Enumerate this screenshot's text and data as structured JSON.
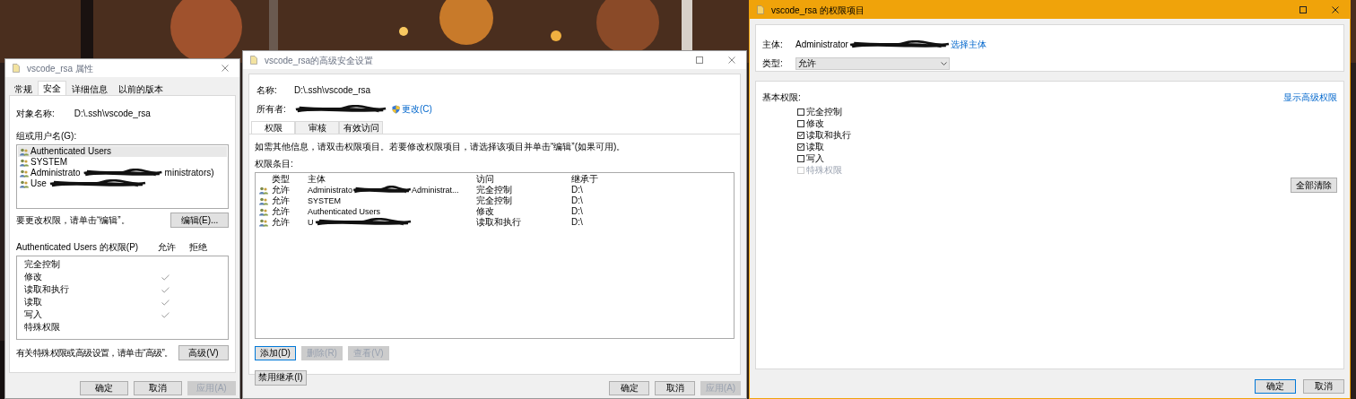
{
  "left_dialog": {
    "title": "vscode_rsa 属性",
    "active": false,
    "tabs": [
      {
        "label": "常规",
        "selected": false
      },
      {
        "label": "安全",
        "selected": true
      },
      {
        "label": "详细信息",
        "selected": false
      },
      {
        "label": "以前的版本",
        "selected": false
      }
    ],
    "object_name_label": "对象名称:",
    "object_name": "D:\\.ssh\\vscode_rsa",
    "groups_label": "组或用户名(G):",
    "groups": [
      {
        "name": "Authenticated Users",
        "redacted": false,
        "selected": true
      },
      {
        "name": "SYSTEM",
        "redacted": false,
        "selected": false
      },
      {
        "name": "Administrato",
        "suffix": "ministrators)",
        "redacted": true,
        "selected": false
      },
      {
        "name": "Use",
        "redacted": true,
        "selected": false
      }
    ],
    "edit_hint": "要更改权限，请单击“编辑”。",
    "edit_button": "编辑(E)...",
    "permissions_label": "Authenticated Users 的权限(P)",
    "allow_header": "允许",
    "deny_header": "拒绝",
    "permissions": [
      {
        "name": "完全控制",
        "allow": false
      },
      {
        "name": "修改",
        "allow": true
      },
      {
        "name": "读取和执行",
        "allow": true
      },
      {
        "name": "读取",
        "allow": true
      },
      {
        "name": "写入",
        "allow": true
      },
      {
        "name": "特殊权限",
        "allow": false
      }
    ],
    "advanced_hint": "有关特殊权限或高级设置，请单击“高级”。",
    "advanced_button": "高级(V)",
    "footer_buttons": [
      {
        "label": "确定",
        "disabled": false,
        "focused": false
      },
      {
        "label": "取消",
        "disabled": false,
        "focused": false
      },
      {
        "label": "应用(A)",
        "disabled": true,
        "focused": false
      }
    ]
  },
  "middle_dialog": {
    "title": "vscode_rsa的高级安全设置",
    "active": false,
    "name_label": "名称:",
    "name": "D:\\.ssh\\vscode_rsa",
    "owner_label": "所有者:",
    "owner_redacted": true,
    "change_link": "更改(C)",
    "tabs": [
      {
        "label": "权限",
        "selected": true
      },
      {
        "label": "审核",
        "selected": false
      },
      {
        "label": "有效访问",
        "selected": false
      }
    ],
    "info": "如需其他信息，请双击权限项目。若要修改权限项目，请选择该项目并单击“编辑”(如果可用)。",
    "entries_label": "权限条目:",
    "columns": [
      "类型",
      "主体",
      "访问",
      "继承于"
    ],
    "rows": [
      {
        "type": "允许",
        "principal": "Administrato",
        "principal_suffix": "Administrat...",
        "redacted": true,
        "access": "完全控制",
        "inherited_from": "D:\\"
      },
      {
        "type": "允许",
        "principal": "SYSTEM",
        "redacted": false,
        "access": "完全控制",
        "inherited_from": "D:\\"
      },
      {
        "type": "允许",
        "principal": "Authenticated Users",
        "redacted": false,
        "access": "修改",
        "inherited_from": "D:\\"
      },
      {
        "type": "允许",
        "principal": "U",
        "redacted": true,
        "access": "读取和执行",
        "inherited_from": "D:\\"
      }
    ],
    "buttons": [
      {
        "label": "添加(D)",
        "disabled": false,
        "focused": true
      },
      {
        "label": "删除(R)",
        "disabled": true,
        "focused": false
      },
      {
        "label": "查看(V)",
        "disabled": true,
        "focused": false
      }
    ],
    "disable_inheritance_button": "禁用继承(I)",
    "footer_buttons": [
      {
        "label": "确定",
        "disabled": false,
        "focused": false
      },
      {
        "label": "取消",
        "disabled": false,
        "focused": false
      },
      {
        "label": "应用(A)",
        "disabled": true,
        "focused": false
      }
    ]
  },
  "right_dialog": {
    "title": "vscode_rsa 的权限项目",
    "active": true,
    "principal_label": "主体:",
    "principal": "Administrator",
    "principal_redacted": true,
    "select_principal_link": "选择主体",
    "type_label": "类型:",
    "type_value": "允许",
    "basic_label": "基本权限:",
    "show_advanced_link": "显示高级权限",
    "permissions": [
      {
        "label": "完全控制",
        "checked": false,
        "disabled": false
      },
      {
        "label": "修改",
        "checked": false,
        "disabled": false
      },
      {
        "label": "读取和执行",
        "checked": true,
        "disabled": false
      },
      {
        "label": "读取",
        "checked": true,
        "disabled": false
      },
      {
        "label": "写入",
        "checked": false,
        "disabled": false
      },
      {
        "label": "特殊权限",
        "checked": false,
        "disabled": true
      }
    ],
    "clear_all_button": "全部清除",
    "footer_buttons": [
      {
        "label": "确定",
        "disabled": false,
        "focused": true
      },
      {
        "label": "取消",
        "disabled": false,
        "focused": false
      }
    ]
  }
}
